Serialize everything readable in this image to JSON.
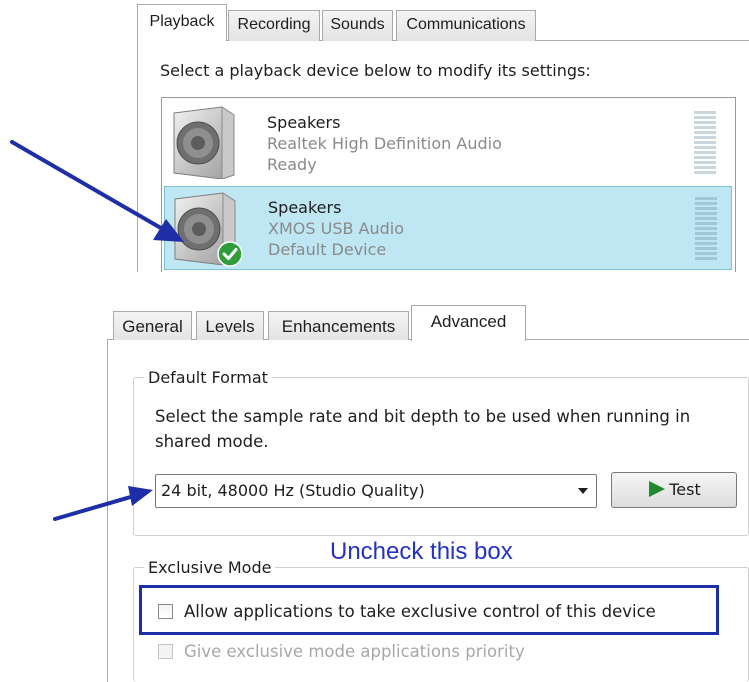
{
  "playback_dialog": {
    "tabs": [
      {
        "label": "Playback",
        "active": true
      },
      {
        "label": "Recording",
        "active": false
      },
      {
        "label": "Sounds",
        "active": false
      },
      {
        "label": "Communications",
        "active": false
      }
    ],
    "prompt": "Select a playback device below to modify its settings:",
    "devices": [
      {
        "name": "Speakers",
        "driver": "Realtek High Definition Audio",
        "status": "Ready",
        "selected": false,
        "icon": "speaker-icon"
      },
      {
        "name": "Speakers",
        "driver": "XMOS USB Audio",
        "status": "Default Device",
        "selected": true,
        "icon": "speaker-icon",
        "badge": "default-check-icon"
      }
    ]
  },
  "properties_dialog": {
    "tabs": [
      {
        "label": "General",
        "active": false
      },
      {
        "label": "Levels",
        "active": false
      },
      {
        "label": "Enhancements",
        "active": false
      },
      {
        "label": "Advanced",
        "active": true
      }
    ],
    "default_format": {
      "title": "Default Format",
      "description": "Select the sample rate and bit depth to be used when running in shared mode.",
      "selected_format": "24 bit, 48000 Hz (Studio Quality)",
      "test_label": "Test"
    },
    "exclusive_mode": {
      "title": "Exclusive Mode",
      "allow_exclusive_label": "Allow applications to take exclusive control of this device",
      "allow_exclusive_checked": false,
      "priority_label": "Give exclusive mode applications priority",
      "priority_checked": false,
      "priority_enabled": false
    }
  },
  "annotations": {
    "callout_text": "Uncheck this box",
    "color": "#1d2ea6"
  },
  "colors": {
    "selection_bg": "#bfe6f3",
    "test_icon": "#1f8a2e",
    "check_badge": "#2f9e3a"
  }
}
